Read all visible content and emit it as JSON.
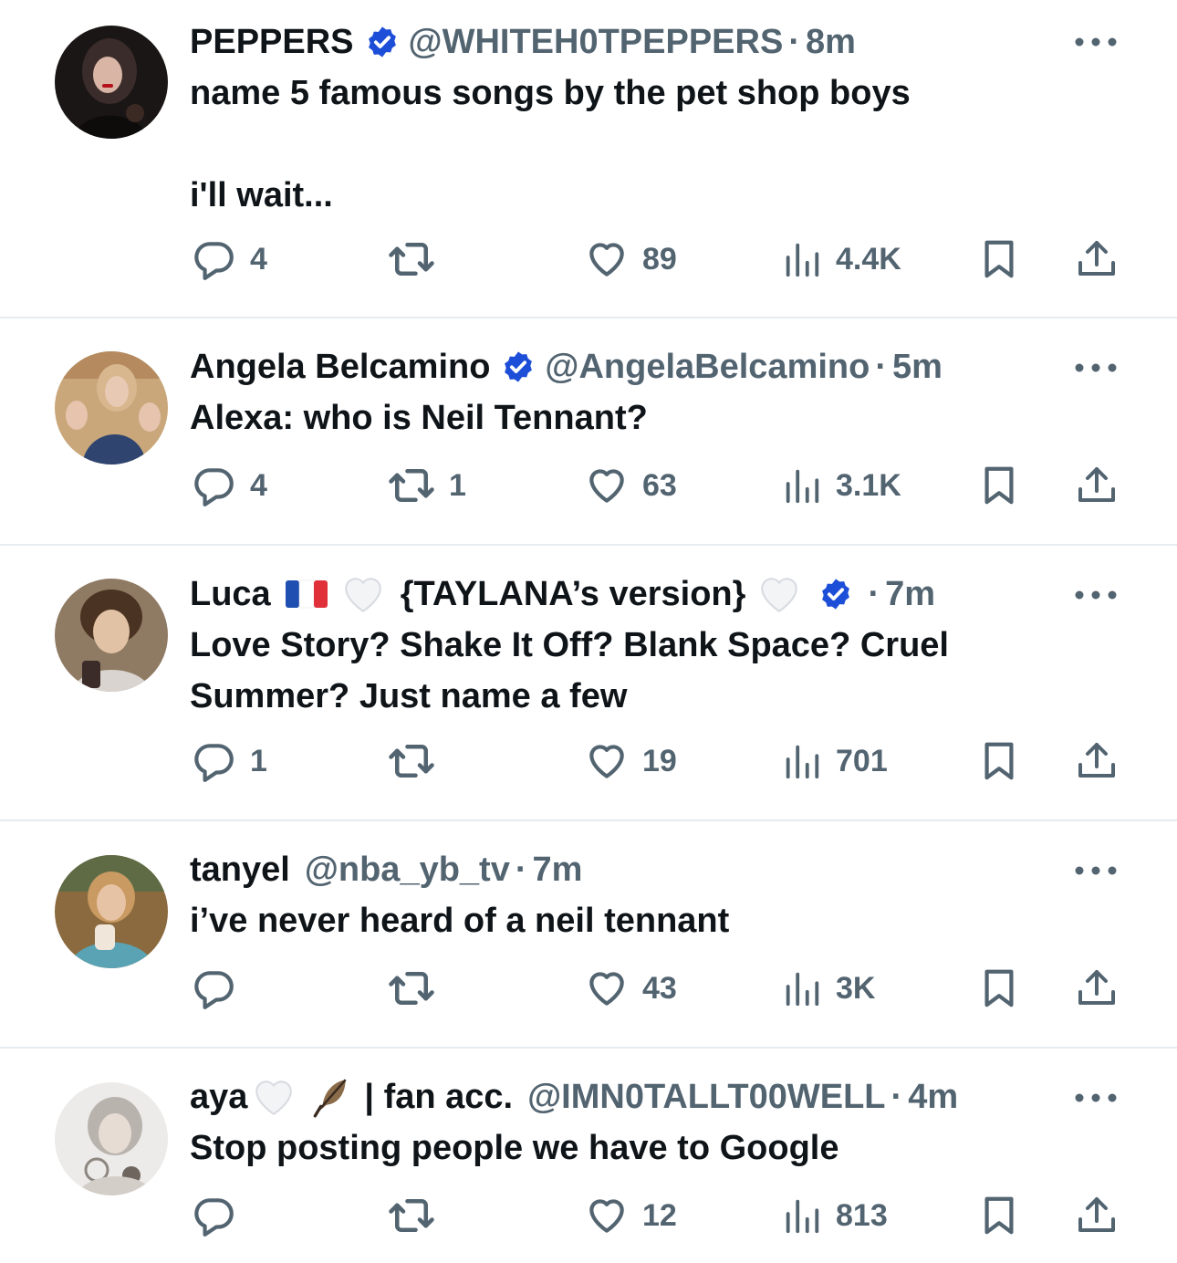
{
  "colors": {
    "text": "#0f1419",
    "secondary": "#536471",
    "verified": "#1d4ed8",
    "divider": "#e6ecf0"
  },
  "tweets": [
    {
      "name": "PEPPERS",
      "verified": true,
      "handle": "@WHITEH0TPEPPERS",
      "time": "8m",
      "text": "name 5 famous songs by the pet shop boys\n\ni'll wait...",
      "replies": "4",
      "retweets": "",
      "likes": "89",
      "views": "4.4K"
    },
    {
      "name": "Angela Belcamino",
      "verified": true,
      "handle": "@AngelaBelcamino",
      "time": "5m",
      "text": "Alexa: who is Neil Tennant?",
      "replies": "4",
      "retweets": "1",
      "likes": "63",
      "views": "3.1K"
    },
    {
      "name": "Luca",
      "name_suffix": "{TAYLANA’s version}",
      "verified": true,
      "handle": "",
      "time": "7m",
      "text": "Love Story? Shake It Off? Blank Space? Cruel\nSummer? Just name a few",
      "replies": "1",
      "retweets": "",
      "likes": "19",
      "views": "701"
    },
    {
      "name": "tanyel",
      "verified": false,
      "handle": "@nba_yb_tv",
      "time": "7m",
      "text": "i’ve never heard of a neil tennant",
      "replies": "",
      "retweets": "",
      "likes": "43",
      "views": "3K"
    },
    {
      "name": "aya",
      "name_suffix": "| fan acc.",
      "verified": false,
      "handle": "@IMN0TALLT00WELL",
      "time": "4m",
      "text": "Stop posting people we have to Google",
      "replies": "",
      "retweets": "",
      "likes": "12",
      "views": "813"
    }
  ]
}
